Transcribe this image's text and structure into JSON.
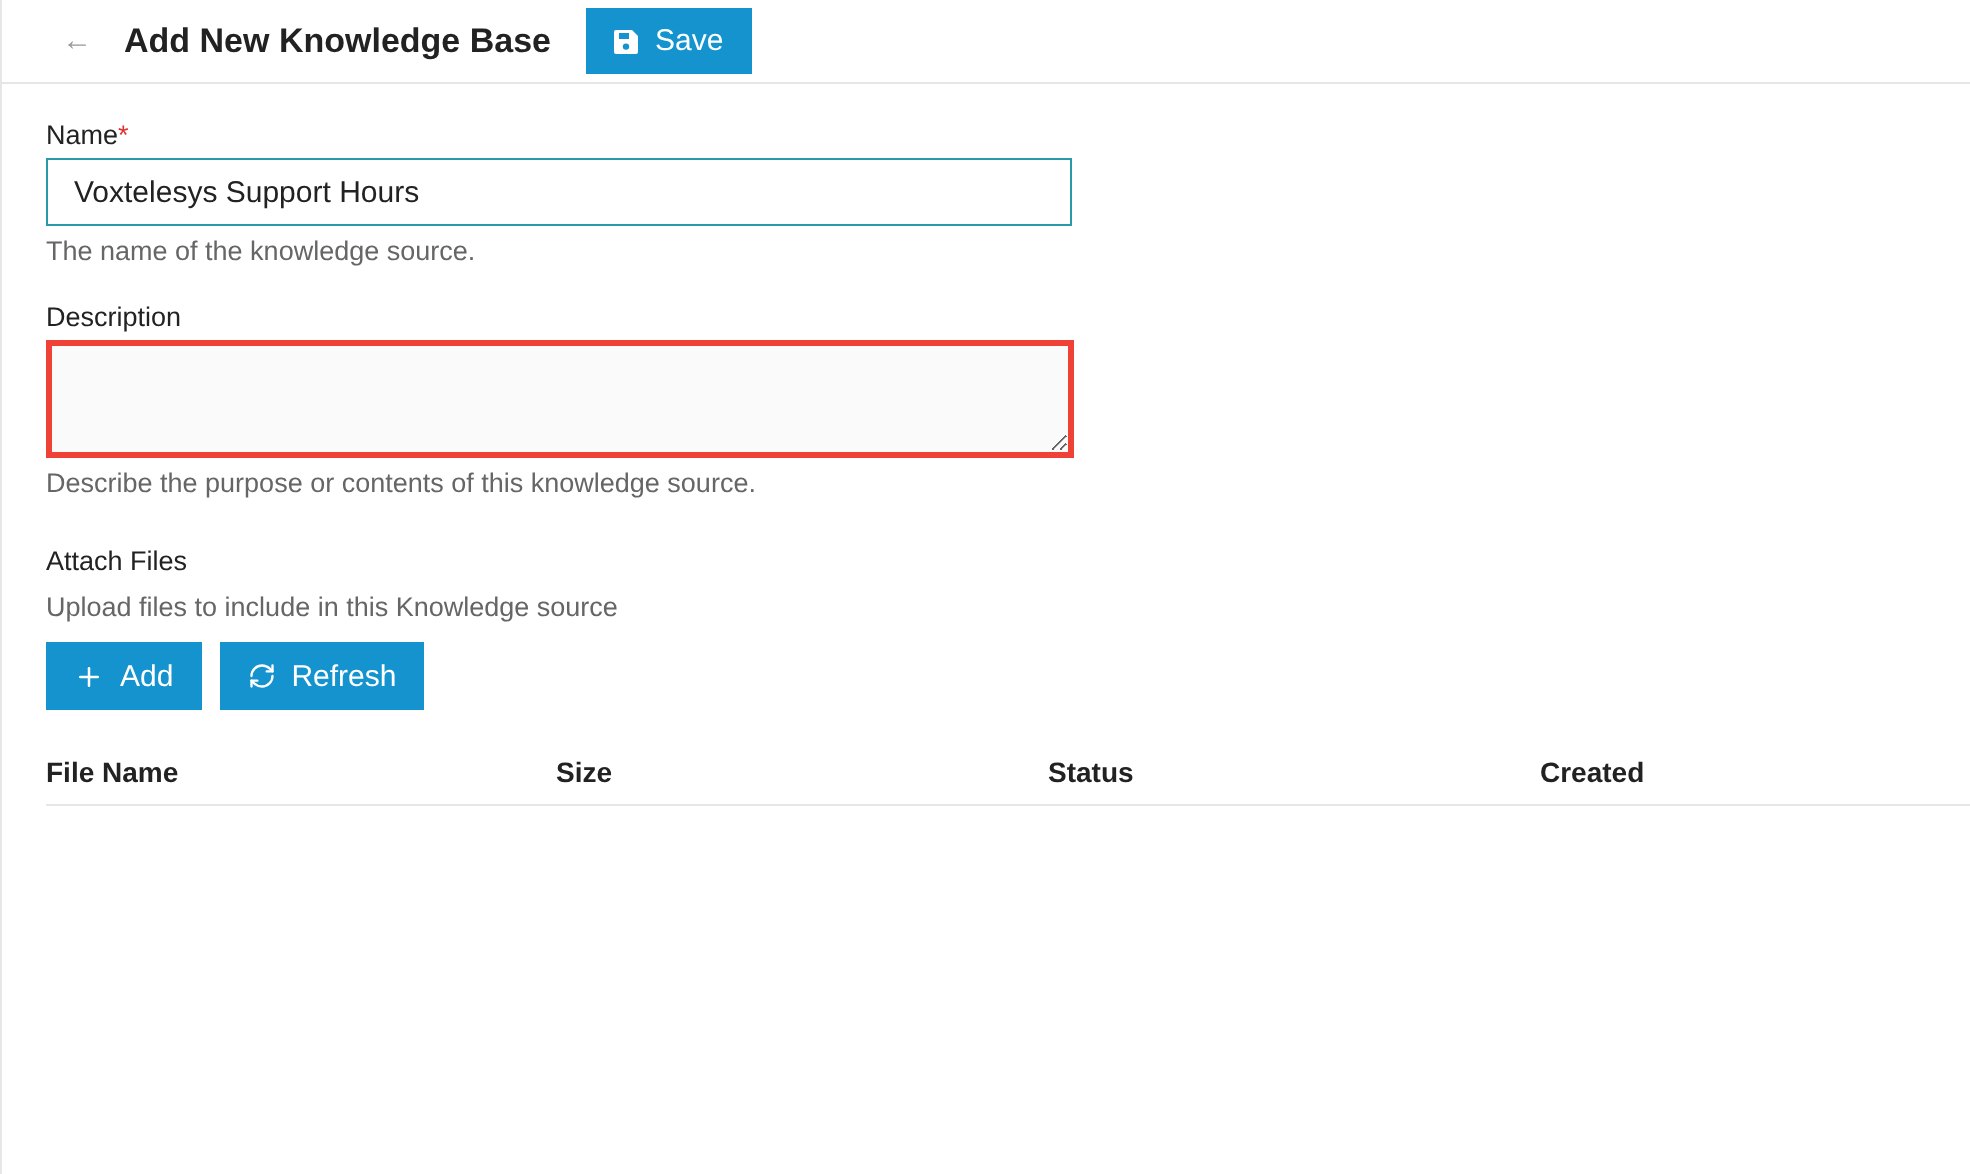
{
  "header": {
    "back": "←",
    "title": "Add New Knowledge Base",
    "save_button": "Save"
  },
  "form": {
    "fields": [
      {
        "kind": "input",
        "label": "Name",
        "required_mark": "*",
        "value": "Voxtelesys Support Hours",
        "focused": true,
        "highlighted": false,
        "help": "The name of the knowledge source."
      },
      {
        "kind": "textarea",
        "label": "Description",
        "focused": false,
        "highlighted": true,
        "help": "Describe the purpose or contents of this knowledge source."
      }
    ]
  },
  "attach": {
    "label": "Attach Files",
    "help": "Upload files to include in this Knowledge source",
    "buttons": [
      {
        "kind": "add",
        "label": "Add"
      },
      {
        "kind": "refresh",
        "label": "Refresh"
      }
    ]
  },
  "table": {
    "columns": [
      "File Name",
      "Size",
      "Status",
      "Created"
    ]
  }
}
